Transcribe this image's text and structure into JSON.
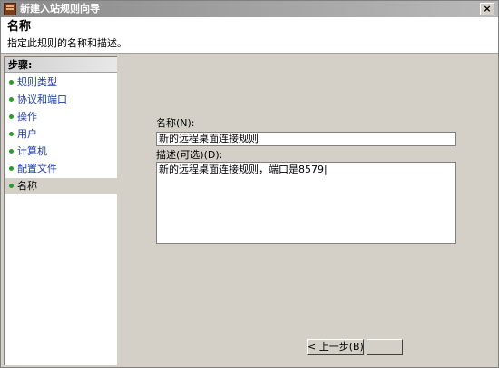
{
  "window": {
    "title": "新建入站规则向导"
  },
  "header": {
    "title": "名称",
    "subtitle": "指定此规则的名称和描述。"
  },
  "sidebar": {
    "header": "步骤:",
    "items": [
      {
        "label": "规则类型"
      },
      {
        "label": "协议和端口"
      },
      {
        "label": "操作"
      },
      {
        "label": "用户"
      },
      {
        "label": "计算机"
      },
      {
        "label": "配置文件"
      },
      {
        "label": "名称"
      }
    ]
  },
  "form": {
    "name_label": "名称(N):",
    "name_value": "新的远程桌面连接规则",
    "desc_label": "描述(可选)(D):",
    "desc_value": "新的远程桌面连接规则，端口是8579|"
  },
  "buttons": {
    "back": "< 上一步(B)"
  },
  "colors": {
    "step_dot": "#2e9a2e",
    "link_text": "#1f3da8",
    "panel_bg": "#d4d0c8"
  }
}
